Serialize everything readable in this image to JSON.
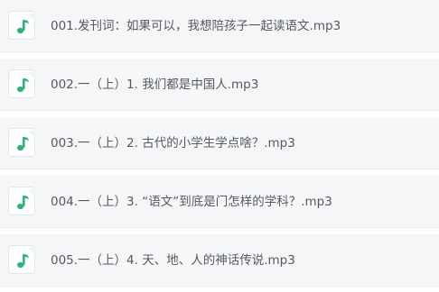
{
  "icon_color": "#2bb673",
  "files": [
    {
      "name": "001.发刊词：如果可以，我想陪孩子一起读语文.mp3",
      "icon": "music-note-icon"
    },
    {
      "name": "002.一（上）1. 我们都是中国人.mp3",
      "icon": "music-note-icon"
    },
    {
      "name": "003.一（上）2. 古代的小学生学点啥？.mp3",
      "icon": "music-note-icon"
    },
    {
      "name": "004.一（上）3. “语文”到底是门怎样的学科？.mp3",
      "icon": "music-note-icon"
    },
    {
      "name": "005.一（上）4. 天、地、人的神话传说.mp3",
      "icon": "music-note-icon"
    }
  ]
}
